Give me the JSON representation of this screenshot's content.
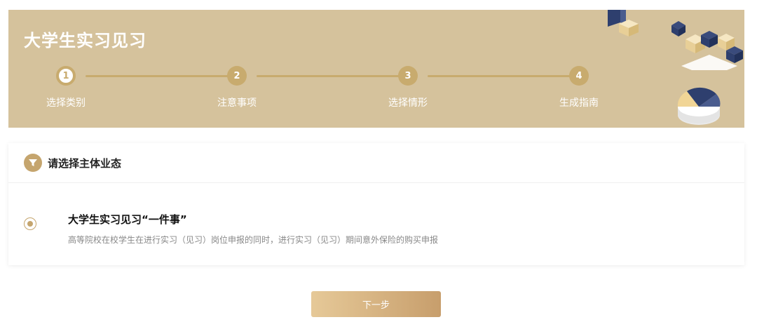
{
  "banner": {
    "title": "大学生实习见习",
    "steps": [
      {
        "number": "1",
        "label": "选择类别",
        "active": true
      },
      {
        "number": "2",
        "label": "注意事项",
        "active": false
      },
      {
        "number": "3",
        "label": "选择情形",
        "active": false
      },
      {
        "number": "4",
        "label": "生成指南",
        "active": false
      }
    ]
  },
  "section": {
    "title": "请选择主体业态",
    "icon": "filter-icon"
  },
  "option": {
    "title": "大学生实习见习“一件事”",
    "description": "高等院校在校学生在进行实习（见习）岗位申报的同时，进行实习（见习）期间意外保险的购买申报",
    "selected": true
  },
  "actions": {
    "next_label": "下一步"
  },
  "colors": {
    "banner_bg": "#d5c29c",
    "accent": "#c5a56e",
    "navy": "#2e3f6e"
  }
}
